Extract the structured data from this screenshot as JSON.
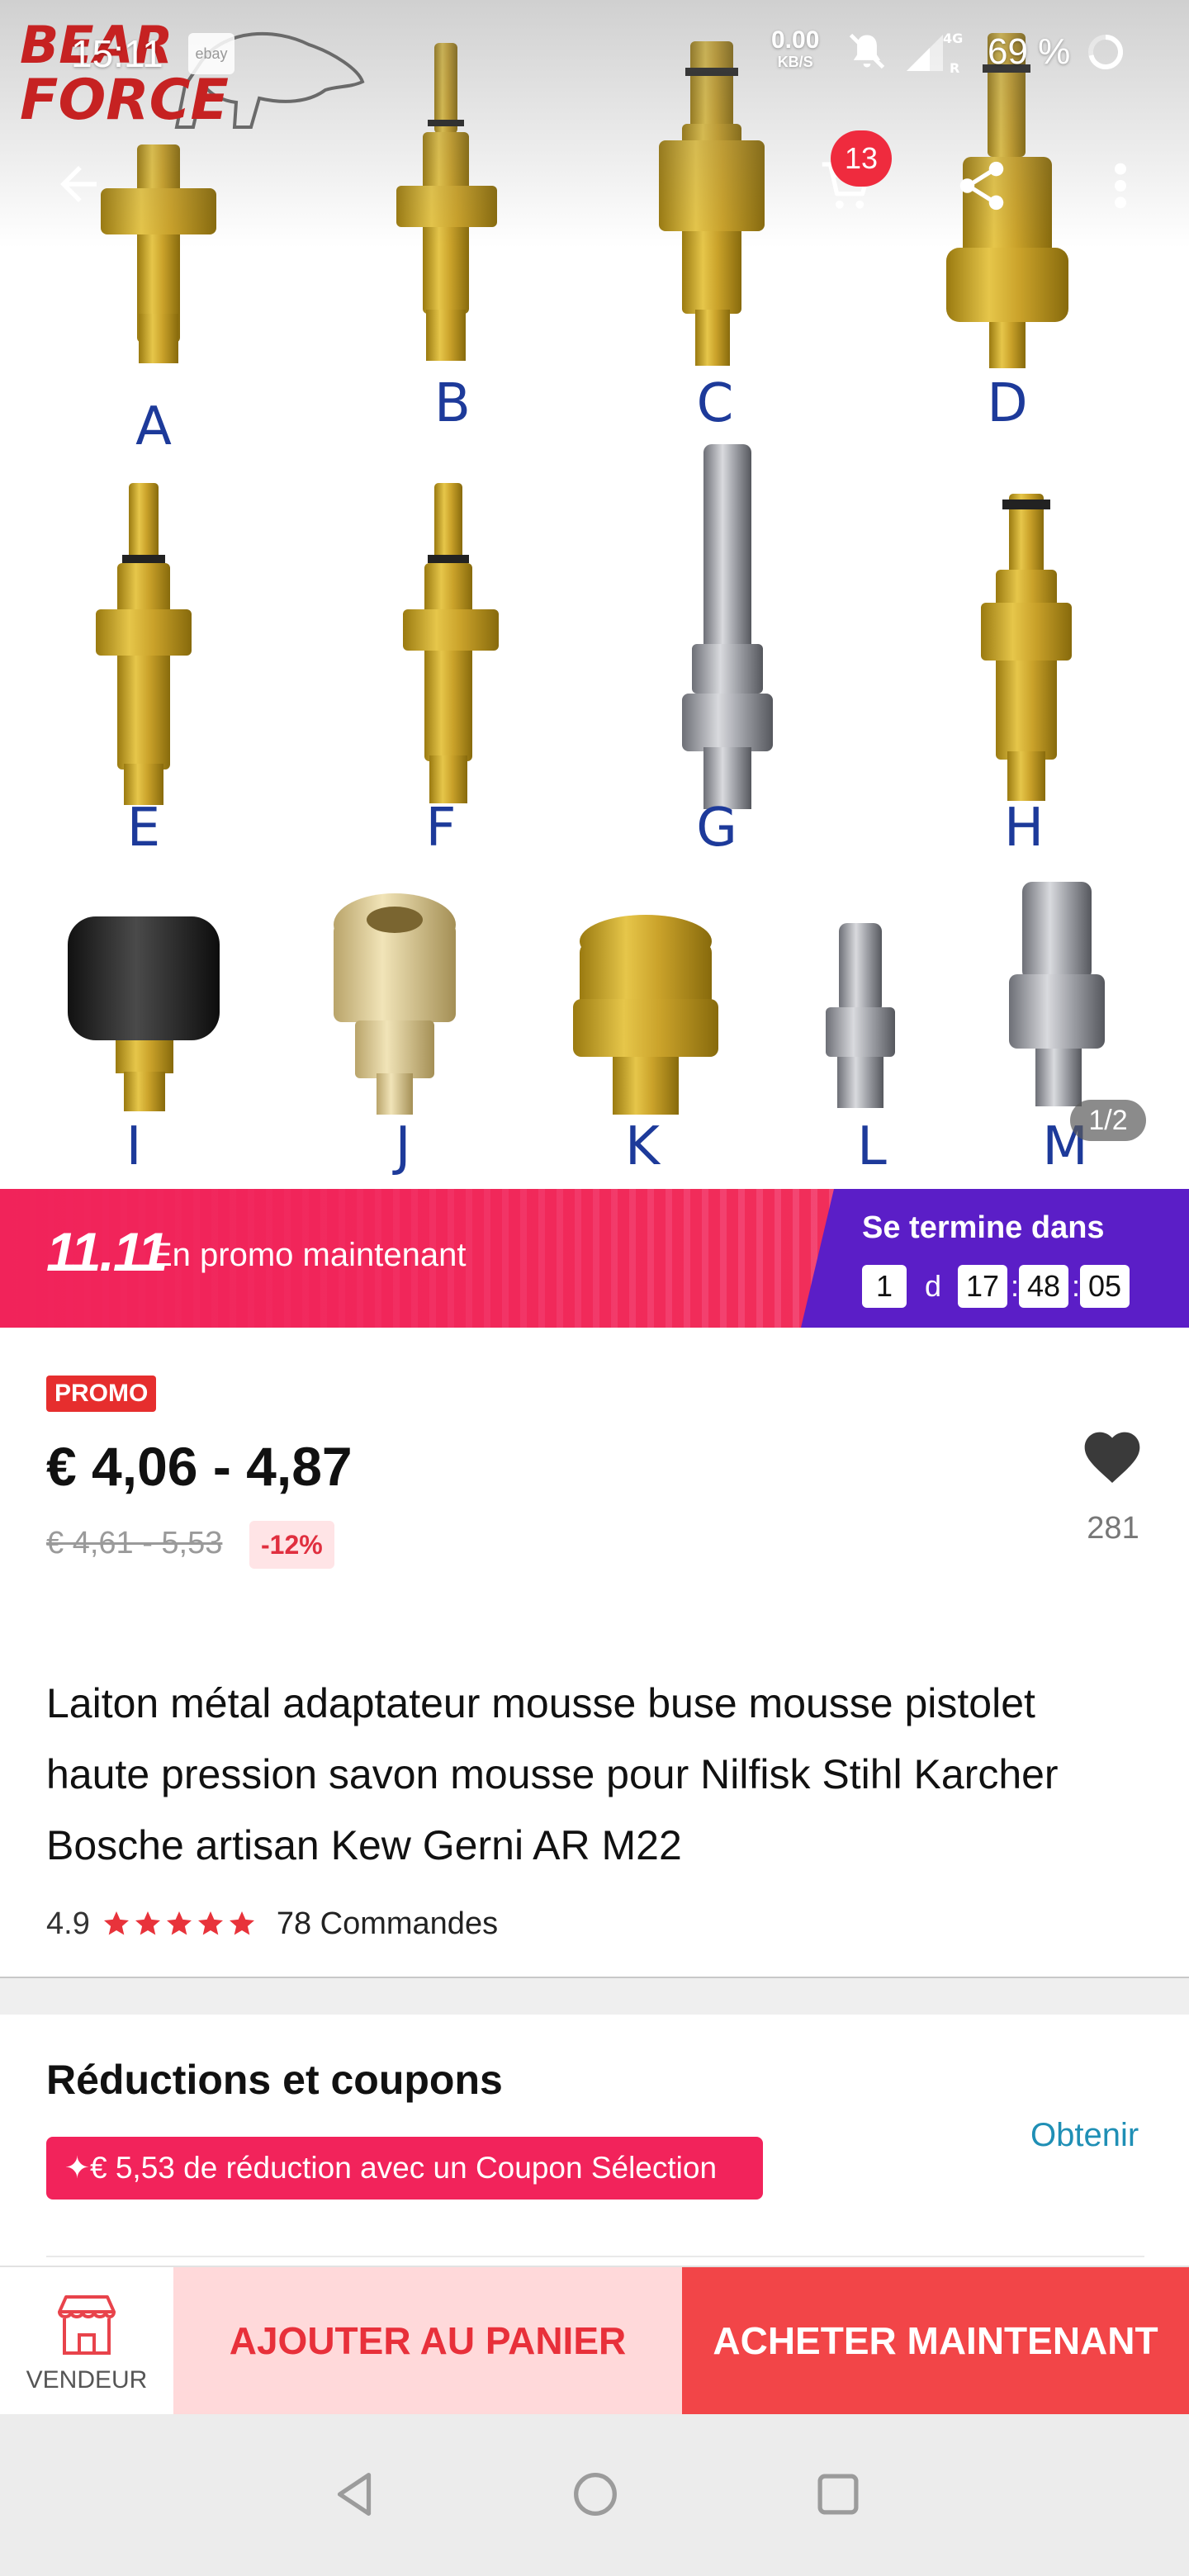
{
  "status_bar": {
    "time": "15:11",
    "ebay_label": "ebay",
    "net_speed_value": "0.00",
    "net_speed_unit": "KB/S",
    "network_label": "4G",
    "battery": "69 %"
  },
  "brand": {
    "name_line1": "BEAR",
    "name_line2": "FORCE"
  },
  "toolbar": {
    "cart_count": "13"
  },
  "gallery": {
    "labels": [
      "A",
      "B",
      "C",
      "D",
      "E",
      "F",
      "G",
      "H",
      "I",
      "J",
      "K",
      "L",
      "M"
    ],
    "counter": "1/2"
  },
  "promo_banner": {
    "event": "11.11",
    "text": "En promo maintenant",
    "ends_label": "Se termine dans",
    "days": "1",
    "days_unit": "d",
    "hours": "17",
    "minutes": "48",
    "seconds": "05"
  },
  "product": {
    "promo_badge": "PROMO",
    "price": "€ 4,06 - 4,87",
    "old_price": "€ 4,61 - 5,53",
    "discount": "-12%",
    "wishlist_count": "281",
    "title": "Laiton métal adaptateur mousse buse mousse pistolet haute pression savon mousse pour Nilfisk Stihl Karcher Bosche artisan Kew Gerni AR M22",
    "rating": "4.9",
    "stars": 5,
    "orders": "78 Commandes"
  },
  "coupons": {
    "title": "Réductions et coupons",
    "obtain": "Obtenir",
    "coupon_text": "✦€ 5,53 de réduction avec un Coupon Sélection"
  },
  "actions": {
    "seller": "VENDEUR",
    "add_to_cart": "AJOUTER AU PANIER",
    "buy_now": "ACHETER MAINTENANT"
  },
  "colors": {
    "accent_red": "#f24548",
    "promo_pink": "#f2235b",
    "countdown_purple": "#5b1ec7",
    "link_blue": "#1f8fb5",
    "label_blue": "#1d3a9a"
  }
}
